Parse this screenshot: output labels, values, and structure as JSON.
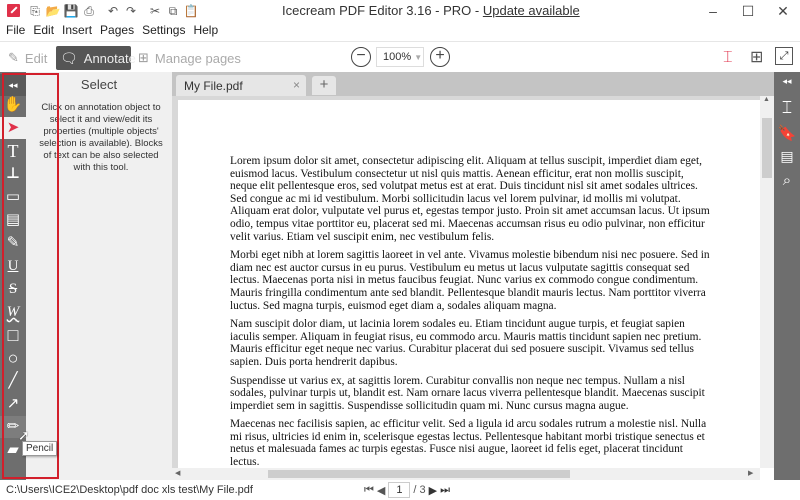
{
  "titlebar": {
    "app_name": "Icecream PDF Editor 3.16 - PRO - ",
    "update_link": "Update available",
    "quick_access": [
      "new-file-icon",
      "open-folder-icon",
      "save-icon",
      "print-icon",
      "undo-icon",
      "redo-icon",
      "cut-icon",
      "copy-icon",
      "paste-icon"
    ],
    "minimize": "‒",
    "maximize": "☐",
    "close": "✕"
  },
  "menu": [
    "File",
    "Edit",
    "Insert",
    "Pages",
    "Settings",
    "Help"
  ],
  "toolbar": {
    "edit_label": "Edit",
    "annotate_label": "Annotate",
    "manage_pages_label": "Manage pages",
    "zoom_value": "100%",
    "zoom_out": "−",
    "zoom_in": "+"
  },
  "tools": [
    {
      "name": "collapse",
      "glyph": "◂◂"
    },
    {
      "name": "hand",
      "glyph": "✋"
    },
    {
      "name": "select",
      "glyph": "➤"
    },
    {
      "name": "text",
      "glyph": "T"
    },
    {
      "name": "stamp",
      "glyph": "⊥"
    },
    {
      "name": "comment",
      "glyph": "▭"
    },
    {
      "name": "textbox",
      "glyph": "▤"
    },
    {
      "name": "highlight",
      "glyph": "✎"
    },
    {
      "name": "underline",
      "glyph": "U"
    },
    {
      "name": "strikeout",
      "glyph": "S"
    },
    {
      "name": "squiggly",
      "glyph": "W"
    },
    {
      "name": "rectangle",
      "glyph": "□"
    },
    {
      "name": "ellipse",
      "glyph": "○"
    },
    {
      "name": "line",
      "glyph": "╱"
    },
    {
      "name": "arrow",
      "glyph": "↗"
    },
    {
      "name": "pencil",
      "glyph": "✏"
    },
    {
      "name": "eraser",
      "glyph": "▰"
    }
  ],
  "side_panel": {
    "title": "Select",
    "description": "Click on annotation object to select it and view/edit its properties (multiple objects' selection is available). Blocks of text can be also selected with this tool."
  },
  "tooltip": "Pencil",
  "tabs": {
    "file_tab": "My File.pdf",
    "close": "×",
    "new_tab": "+"
  },
  "document": {
    "paragraphs": [
      "Lorem ipsum dolor sit amet, consectetur adipiscing elit. Aliquam at tellus suscipit, imperdiet diam eget, euismod lacus. Vestibulum consectetur ut nisl quis mattis. Aenean efficitur, erat non mollis suscipit, neque elit pellentesque eros, sed volutpat metus est at erat. Duis tincidunt nisl sit amet sodales ultrices. Sed congue ac mi id vestibulum. Morbi sollicitudin lacus vel lorem pulvinar, id mollis mi volutpat. Aliquam erat dolor, vulputate vel purus et, egestas tempor justo. Proin sit amet accumsan lacus. Ut ipsum odio, tempus vitae porttitor eu, placerat sed mi. Maecenas accumsan risus eu odio pulvinar, non efficitur velit varius. Etiam vel suscipit enim, nec vestibulum felis.",
      "Morbi eget nibh at lorem sagittis laoreet in vel ante. Vivamus molestie bibendum nisi nec posuere. Sed in diam nec est auctor cursus in eu purus. Vestibulum eu metus ut lacus vulputate sagittis consequat sed lectus. Maecenas porta nisi in metus faucibus feugiat. Nunc varius ex commodo congue condimentum. Mauris fringilla condimentum ante sed blandit. Pellentesque blandit mauris lectus. Nam porttitor viverra luctus. Sed magna turpis, euismod eget diam a, sodales aliquam magna.",
      "Nam suscipit dolor diam, ut lacinia lorem sodales eu. Etiam tincidunt augue turpis, et feugiat sapien iaculis semper. Aliquam in feugiat risus, eu commodo arcu. Mauris mattis tincidunt sapien nec pretium. Mauris efficitur eget neque nec varius. Curabitur placerat dui sed posuere suscipit. Vivamus sed tellus sapien. Duis porta hendrerit dapibus.",
      "Suspendisse ut varius ex, at sagittis lorem. Curabitur convallis non neque nec tempus. Nullam a nisl sodales, pulvinar turpis ut, blandit est. Nam ornare lacus viverra pellentesque blandit. Maecenas suscipit imperdiet sem in sagittis. Suspendisse sollicitudin quam mi. Nunc cursus magna augue.",
      "Maecenas nec facilisis sapien, ac efficitur velit. Sed a ligula id arcu sodales rutrum a molestie nisl. Nulla mi risus, ultricies id enim in, scelerisque egestas lectus. Pellentesque habitant morbi tristique senectus et netus et malesuada fames ac turpis egestas. Fusce nisi augue, laoreet id felis eget, placerat tincidunt lectus."
    ]
  },
  "status": {
    "file_path": "C:\\Users\\ICE2\\Desktop\\pdf doc xls test\\My File.pdf",
    "current_page": "1",
    "total_pages": "/ 3"
  },
  "colors": {
    "accent": "#e0314a",
    "highlight_box": "#d21f2b",
    "toolstrip": "#6e6e6e"
  }
}
